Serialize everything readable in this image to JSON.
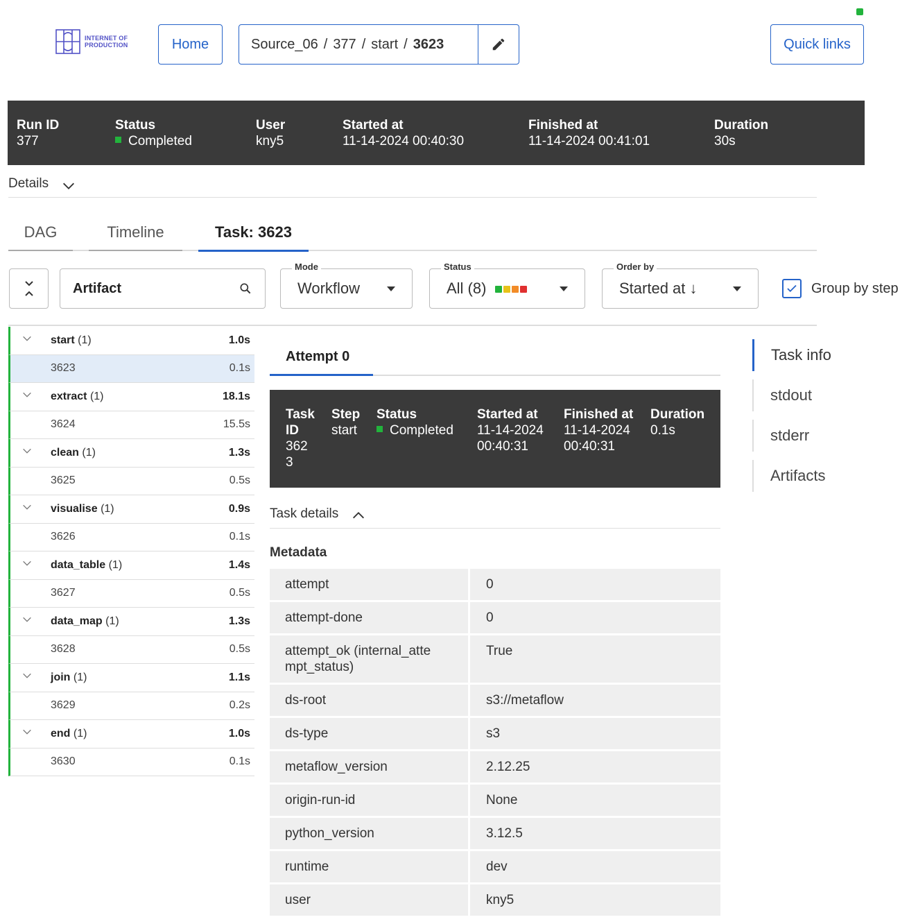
{
  "header": {
    "logo_text": [
      "INTERNET OF",
      "PRODUCTION"
    ],
    "home_label": "Home",
    "breadcrumb": [
      "Source_06",
      "377",
      "start",
      "3623"
    ],
    "breadcrumb_sep": "/",
    "quick_links_label": "Quick links",
    "status_indicator_color": "#22b33c"
  },
  "run": {
    "run_id_label": "Run ID",
    "run_id": "377",
    "status_label": "Status",
    "status": "Completed",
    "user_label": "User",
    "user": "kny5",
    "started_label": "Started at",
    "started": "11-14-2024 00:40:30",
    "finished_label": "Finished at",
    "finished": "11-14-2024 00:41:01",
    "duration_label": "Duration",
    "duration": "30s"
  },
  "details_label": "Details",
  "tabs": [
    {
      "label": "DAG"
    },
    {
      "label": "Timeline"
    },
    {
      "label": "Task: 3623"
    }
  ],
  "toolbar": {
    "search_value": "Artifact",
    "mode_label": "Mode",
    "mode_value": "Workflow",
    "status_label": "Status",
    "status_value": "All (8)",
    "status_colors": [
      "#22b33c",
      "#e8c21a",
      "#f28c28",
      "#e03030"
    ],
    "order_label": "Order by",
    "order_value": "Started at ↓",
    "group_by_label": "Group by step",
    "group_by_checked": true
  },
  "steps": [
    {
      "name": "start",
      "count": "(1)",
      "time": "1.0s",
      "task_id": "3623",
      "task_time": "0.1s"
    },
    {
      "name": "extract",
      "count": "(1)",
      "time": "18.1s",
      "task_id": "3624",
      "task_time": "15.5s"
    },
    {
      "name": "clean",
      "count": "(1)",
      "time": "1.3s",
      "task_id": "3625",
      "task_time": "0.5s"
    },
    {
      "name": "visualise",
      "count": "(1)",
      "time": "0.9s",
      "task_id": "3626",
      "task_time": "0.1s"
    },
    {
      "name": "data_table",
      "count": "(1)",
      "time": "1.4s",
      "task_id": "3627",
      "task_time": "0.5s"
    },
    {
      "name": "data_map",
      "count": "(1)",
      "time": "1.3s",
      "task_id": "3628",
      "task_time": "0.5s"
    },
    {
      "name": "join",
      "count": "(1)",
      "time": "1.1s",
      "task_id": "3629",
      "task_time": "0.2s"
    },
    {
      "name": "end",
      "count": "(1)",
      "time": "1.0s",
      "task_id": "3630",
      "task_time": "0.1s"
    }
  ],
  "attempt": {
    "label": "Attempt 0"
  },
  "task": {
    "task_id_label": "Task\nID",
    "task_id": "362\n3",
    "step_label": "Step",
    "step": "start",
    "status_label": "Status",
    "status": "Completed",
    "started_label": "Started at",
    "started": "11-14-2024\n00:40:31",
    "finished_label": "Finished at",
    "finished": "11-14-2024\n00:40:31",
    "duration_label": "Duration",
    "duration": "0.1s"
  },
  "task_details_label": "Task details",
  "metadata_label": "Metadata",
  "metadata": [
    {
      "key": "attempt",
      "value": "0"
    },
    {
      "key": "attempt-done",
      "value": "0"
    },
    {
      "key": "attempt_ok (internal_atte\nmpt_status)",
      "value": "True"
    },
    {
      "key": "ds-root",
      "value": "s3://metaflow"
    },
    {
      "key": "ds-type",
      "value": "s3"
    },
    {
      "key": "metaflow_version",
      "value": "2.12.25"
    },
    {
      "key": "origin-run-id",
      "value": "None"
    },
    {
      "key": "python_version",
      "value": "3.12.5"
    },
    {
      "key": "runtime",
      "value": "dev"
    },
    {
      "key": "user",
      "value": "kny5"
    }
  ],
  "right_nav": [
    {
      "label": "Task info"
    },
    {
      "label": "stdout"
    },
    {
      "label": "stderr"
    },
    {
      "label": "Artifacts"
    }
  ]
}
